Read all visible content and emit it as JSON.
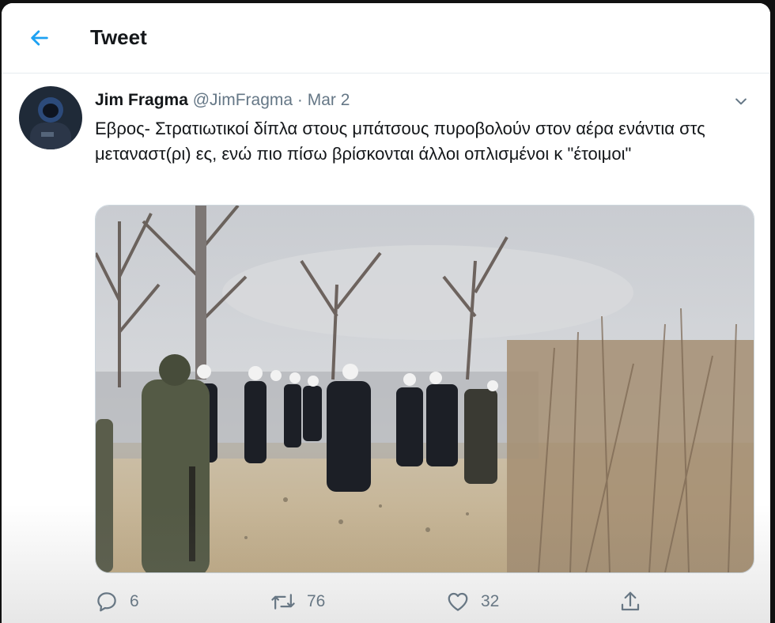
{
  "header": {
    "title": "Tweet",
    "back_icon": "arrow-left-icon",
    "accent_color": "#1da1f2"
  },
  "tweet": {
    "author_name": "Jim Fragma",
    "handle": "@JimFragma",
    "separator": "·",
    "date": "Mar 2",
    "text": "Εβρος- Στρατιωτικοί δίπλα στους μπάτσους πυροβολούν στον αέρα ενάντια στς μεταναστ(ρι) ες, ενώ πιο πίσω  βρίσκονται άλλοι οπλισμένοι κ \"έτοιμοι\"",
    "caret_icon": "chevron-down-icon"
  },
  "actions": {
    "reply_count": "6",
    "retweet_count": "76",
    "like_count": "32",
    "reply_icon": "reply-icon",
    "retweet_icon": "retweet-icon",
    "like_icon": "heart-icon",
    "share_icon": "share-icon"
  }
}
